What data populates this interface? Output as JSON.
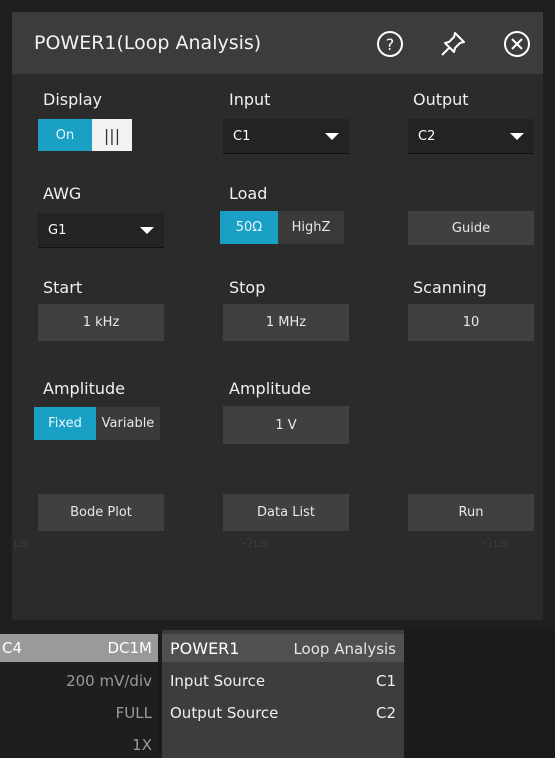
{
  "dialog": {
    "title": "POWER1(Loop Analysis)",
    "icons": [
      "help-icon",
      "pin-icon",
      "close-icon"
    ]
  },
  "display": {
    "label": "Display",
    "on_label": "On",
    "off_label": "|||",
    "state": "On"
  },
  "input": {
    "label": "Input",
    "value": "C1"
  },
  "output": {
    "label": "Output",
    "value": "C2"
  },
  "awg": {
    "label": "AWG",
    "value": "G1"
  },
  "load": {
    "label": "Load",
    "option_a": "50Ω",
    "option_b": "HighZ",
    "selected": "50Ω"
  },
  "guide": {
    "label": "Guide"
  },
  "start": {
    "label": "Start",
    "value": "1 kHz"
  },
  "stop": {
    "label": "Stop",
    "value": "1 MHz"
  },
  "scanning": {
    "label": "Scanning",
    "value": "10"
  },
  "amplitude_mode": {
    "label": "Amplitude",
    "option_a": "Fixed",
    "option_b": "Variable",
    "selected": "Fixed"
  },
  "amplitude_value": {
    "label": "Amplitude",
    "value": "1 V"
  },
  "actions": {
    "bode_plot": "Bode Plot",
    "data_list": "Data List",
    "run": "Run"
  },
  "background_ticks": {
    "left": "μs",
    "mid": "-2μs",
    "right": "-1μs"
  },
  "channel4": {
    "name": "C4",
    "coupling": "DC1M",
    "scale": "200 mV/div",
    "bandwidth": "FULL",
    "probe": "1X"
  },
  "power_info": {
    "name": "POWER1",
    "mode": "Loop Analysis",
    "input_source_label": "Input Source",
    "input_source_value": "C1",
    "output_source_label": "Output Source",
    "output_source_value": "C2"
  },
  "colors": {
    "accent": "#1aa0c4",
    "panel": "#2b2b2b",
    "titlebar": "#3c3c3c",
    "button": "#404040"
  }
}
